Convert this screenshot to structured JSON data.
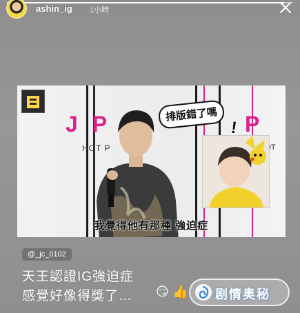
{
  "story": {
    "progress": 0.97,
    "username": "ashin_ig",
    "time_ago": "1小時",
    "close_icon": "close-icon",
    "avatar_icon": "avatar"
  },
  "shared_post": {
    "background_text_left": "J P",
    "background_text_right": "P O",
    "background_hotpot": "HOT P",
    "background_pot": "POT",
    "logo_text": "吾\n說",
    "speech_bubble": "排版錯了嗎",
    "exclamation": "!",
    "subtitle": "我覺得他有那種  強迫症"
  },
  "mention": "@_jc_0102",
  "caption": {
    "line1": "天王認證IG強迫症",
    "line2": "感覺好像得獎了…"
  },
  "emojis": [
    "😏",
    "👍"
  ],
  "watermark": {
    "text": "剧情奥秘"
  },
  "colors": {
    "accent_pink": "#d9228c",
    "background": "#939393"
  }
}
